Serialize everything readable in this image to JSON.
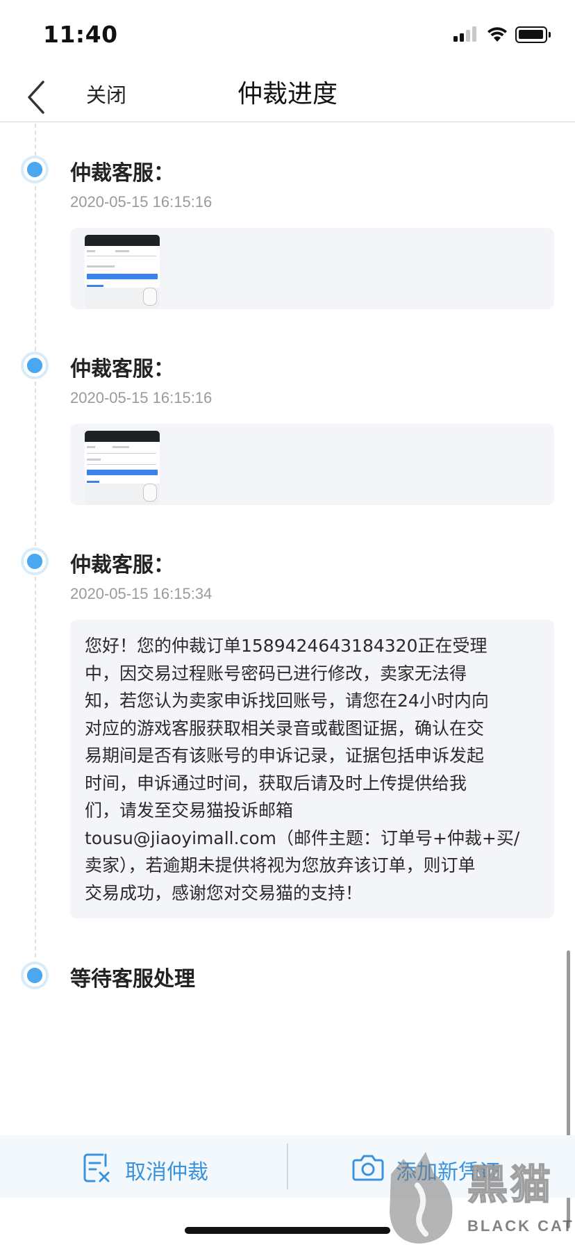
{
  "status_bar": {
    "time": "11:40"
  },
  "nav": {
    "close_label": "关闭",
    "title": "仲裁进度"
  },
  "timeline": [
    {
      "title": "仲裁客服：",
      "time": "2020-05-15 16:15:16",
      "attachment": "screenshot-thumbnail"
    },
    {
      "title": "仲裁客服：",
      "time": "2020-05-15 16:15:16",
      "attachment": "screenshot-thumbnail"
    },
    {
      "title": "仲裁客服：",
      "time": "2020-05-15 16:15:34",
      "message_lines": [
        "您好！您的仲裁订单1589424643184320正在受理",
        "中，因交易过程账号密码已进行修改，卖家无法得",
        "知，若您认为卖家申诉找回账号，请您在24小时内向",
        "对应的游戏客服获取相关录音或截图证据，确认在交",
        "易期间是否有该账号的申诉记录，证据包括申诉发起",
        "时间，申诉通过时间，获取后请及时上传提供给我",
        "们，请发至交易猫投诉邮箱",
        "tousu@jiaoyimall.com（邮件主题：订单号+仲裁+买/",
        "卖家），若逾期未提供将视为您放弃该订单，则订单",
        "交易成功，感谢您对交易猫的支持！"
      ]
    },
    {
      "title": "等待客服处理"
    }
  ],
  "bottom_bar": {
    "cancel_label": "取消仲裁",
    "add_evidence_label": "添加新凭证"
  },
  "watermark": {
    "cn": "黑猫",
    "en": "BLACK CAT"
  },
  "colors": {
    "accent": "#3a92dd",
    "dot": "#4ba8f0",
    "card_bg": "#f4f5f9"
  }
}
